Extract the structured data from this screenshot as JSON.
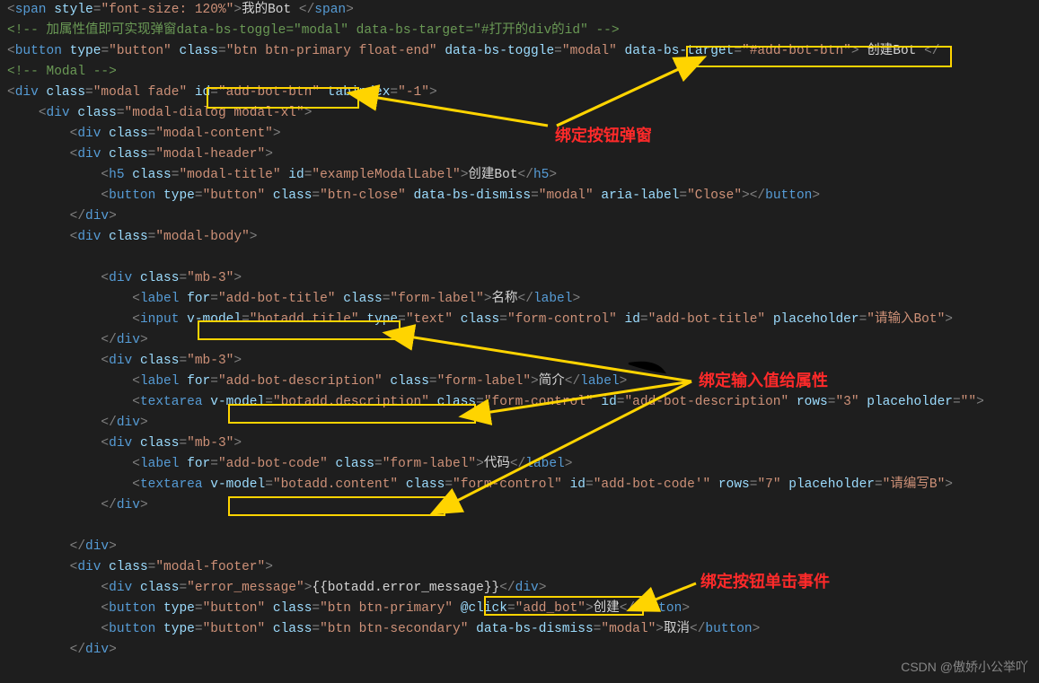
{
  "code": {
    "lines": [
      {
        "indent": 0,
        "type": "open",
        "tag": "span",
        "attrs": [
          [
            "style",
            "font-size: 120%"
          ]
        ],
        "text": "我的Bot ",
        "close": "span"
      },
      {
        "indent": 0,
        "type": "comment",
        "text": "<!-- 加属性值即可实现弹窗data-bs-toggle=\"modal\" data-bs-target=\"#打开的div的id\" -->"
      },
      {
        "indent": 0,
        "type": "open",
        "tag": "button",
        "attrs": [
          [
            "type",
            "button"
          ],
          [
            "class",
            "btn btn-primary float-end"
          ],
          [
            "data-bs-toggle",
            "modal"
          ],
          [
            "data-bs-target",
            "#add-bot-btn"
          ]
        ],
        "text": " 创建Bot ",
        "close": "",
        "trail": "</"
      },
      {
        "indent": 0,
        "type": "comment",
        "text": "<!-- Modal -->"
      },
      {
        "indent": 0,
        "type": "open",
        "tag": "div",
        "attrs": [
          [
            "class",
            "modal fade"
          ],
          [
            "id",
            "add-bot-btn"
          ],
          [
            "tabindex",
            "-1"
          ]
        ]
      },
      {
        "indent": 1,
        "type": "open",
        "tag": "div",
        "attrs": [
          [
            "class",
            "modal-dialog modal-xl"
          ]
        ]
      },
      {
        "indent": 2,
        "type": "open",
        "tag": "div",
        "attrs": [
          [
            "class",
            "modal-content"
          ]
        ]
      },
      {
        "indent": 2,
        "type": "open",
        "tag": "div",
        "attrs": [
          [
            "class",
            "modal-header"
          ]
        ]
      },
      {
        "indent": 3,
        "type": "open",
        "tag": "h5",
        "attrs": [
          [
            "class",
            "modal-title"
          ],
          [
            "id",
            "exampleModalLabel"
          ]
        ],
        "text": "创建Bot",
        "close": "h5"
      },
      {
        "indent": 3,
        "type": "open",
        "tag": "button",
        "attrs": [
          [
            "type",
            "button"
          ],
          [
            "class",
            "btn-close"
          ],
          [
            "data-bs-dismiss",
            "modal"
          ],
          [
            "aria-label",
            "Close"
          ]
        ],
        "text": "",
        "close": "button"
      },
      {
        "indent": 2,
        "type": "close",
        "tag": "div"
      },
      {
        "indent": 2,
        "type": "open",
        "tag": "div",
        "attrs": [
          [
            "class",
            "modal-body"
          ]
        ]
      },
      {
        "indent": 0,
        "type": "blank"
      },
      {
        "indent": 3,
        "type": "open",
        "tag": "div",
        "attrs": [
          [
            "class",
            "mb-3"
          ]
        ]
      },
      {
        "indent": 4,
        "type": "open",
        "tag": "label",
        "attrs": [
          [
            "for",
            "add-bot-title"
          ],
          [
            "class",
            "form-label"
          ]
        ],
        "text": "名称",
        "close": "label"
      },
      {
        "indent": 4,
        "type": "open",
        "tag": "input",
        "attrs": [
          [
            "v-model",
            "botadd.title"
          ],
          [
            "type",
            "text"
          ],
          [
            "class",
            "form-control"
          ],
          [
            "id",
            "add-bot-title"
          ],
          [
            "placeholder",
            "请输入Bot"
          ]
        ]
      },
      {
        "indent": 3,
        "type": "close",
        "tag": "div"
      },
      {
        "indent": 3,
        "type": "open",
        "tag": "div",
        "attrs": [
          [
            "class",
            "mb-3"
          ]
        ]
      },
      {
        "indent": 4,
        "type": "open",
        "tag": "label",
        "attrs": [
          [
            "for",
            "add-bot-description"
          ],
          [
            "class",
            "form-label"
          ]
        ],
        "text": "简介",
        "close": "label"
      },
      {
        "indent": 4,
        "type": "open",
        "tag": "textarea",
        "attrs": [
          [
            "v-model",
            "botadd.description"
          ],
          [
            "class",
            "form-control"
          ],
          [
            "id",
            "add-bot-description"
          ],
          [
            "rows",
            "3"
          ],
          [
            "placeholder",
            ""
          ]
        ]
      },
      {
        "indent": 3,
        "type": "close",
        "tag": "div"
      },
      {
        "indent": 3,
        "type": "open",
        "tag": "div",
        "attrs": [
          [
            "class",
            "mb-3"
          ]
        ]
      },
      {
        "indent": 4,
        "type": "open",
        "tag": "label",
        "attrs": [
          [
            "for",
            "add-bot-code"
          ],
          [
            "class",
            "form-label"
          ]
        ],
        "text": "代码",
        "close": "label"
      },
      {
        "indent": 4,
        "type": "open",
        "tag": "textarea",
        "attrs": [
          [
            "v-model",
            "botadd.content"
          ],
          [
            "class",
            "form-control"
          ],
          [
            "id",
            "add-bot-code'"
          ],
          [
            "rows",
            "7"
          ],
          [
            "placeholder",
            "请编写B"
          ]
        ]
      },
      {
        "indent": 3,
        "type": "close",
        "tag": "div"
      },
      {
        "indent": 0,
        "type": "blank"
      },
      {
        "indent": 2,
        "type": "close",
        "tag": "div"
      },
      {
        "indent": 2,
        "type": "open",
        "tag": "div",
        "attrs": [
          [
            "class",
            "modal-footer"
          ]
        ]
      },
      {
        "indent": 3,
        "type": "open",
        "tag": "div",
        "attrs": [
          [
            "class",
            "error_message"
          ]
        ],
        "mustache": "{{botadd.error_message}}",
        "close": "div"
      },
      {
        "indent": 3,
        "type": "open",
        "tag": "button",
        "attrs": [
          [
            "type",
            "button"
          ],
          [
            "class",
            "btn btn-primary"
          ],
          [
            "@click",
            "add_bot"
          ]
        ],
        "text": "创建",
        "close": "button"
      },
      {
        "indent": 3,
        "type": "open",
        "tag": "button",
        "attrs": [
          [
            "type",
            "button"
          ],
          [
            "class",
            "btn btn-secondary"
          ],
          [
            "data-bs-dismiss",
            "modal"
          ]
        ],
        "text": "取消",
        "close": "button"
      },
      {
        "indent": 2,
        "type": "close",
        "tag": "div"
      }
    ]
  },
  "annotations": {
    "a1": "绑定按钮弹窗",
    "a2": "绑定输入值给属性",
    "a3": "绑定按钮单击事件"
  },
  "watermark": "CSDN @傲娇小公举吖"
}
